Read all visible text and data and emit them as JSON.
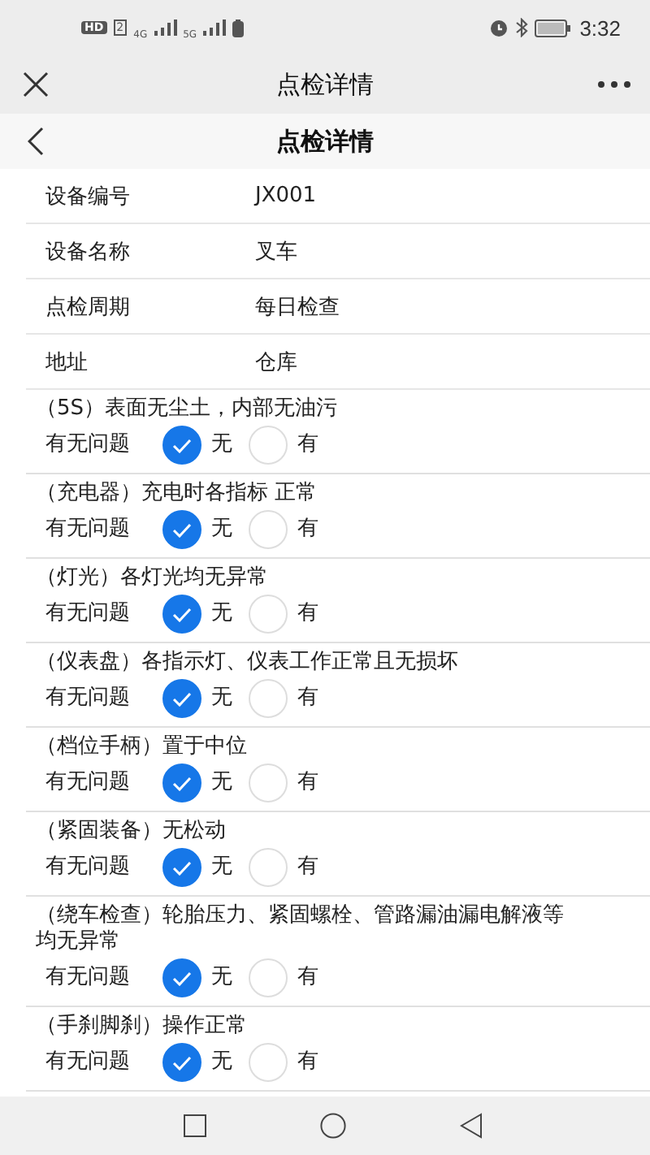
{
  "status_bar": {
    "time": "3:32",
    "hd": "HD",
    "sim": "2",
    "net_1": "4G",
    "net_2": "5G"
  },
  "header": {
    "title": "点检详情"
  },
  "subheader": {
    "title": "点检详情"
  },
  "info_rows": [
    {
      "label": "设备编号",
      "value": "JX001"
    },
    {
      "label": "设备名称",
      "value": "叉车"
    },
    {
      "label": "点检周期",
      "value": "每日检查"
    },
    {
      "label": "地址",
      "value": "仓库"
    }
  ],
  "check_items": [
    {
      "title": "（5S）表面无尘土，内部无油污",
      "question": "有无问题",
      "options": [
        {
          "label": "无",
          "selected": true
        },
        {
          "label": "有",
          "selected": false
        }
      ]
    },
    {
      "title": "（充电器）充电时各指标 正常",
      "question": "有无问题",
      "options": [
        {
          "label": "无",
          "selected": true
        },
        {
          "label": "有",
          "selected": false
        }
      ]
    },
    {
      "title": "（灯光）各灯光均无异常",
      "question": "有无问题",
      "options": [
        {
          "label": "无",
          "selected": true
        },
        {
          "label": "有",
          "selected": false
        }
      ]
    },
    {
      "title": "（仪表盘）各指示灯、仪表工作正常且无损坏",
      "question": "有无问题",
      "options": [
        {
          "label": "无",
          "selected": true
        },
        {
          "label": "有",
          "selected": false
        }
      ]
    },
    {
      "title": "（档位手柄）置于中位",
      "question": "有无问题",
      "options": [
        {
          "label": "无",
          "selected": true
        },
        {
          "label": "有",
          "selected": false
        }
      ]
    },
    {
      "title": "（紧固装备）无松动",
      "question": "有无问题",
      "options": [
        {
          "label": "无",
          "selected": true
        },
        {
          "label": "有",
          "selected": false
        }
      ]
    },
    {
      "title": "（绕车检查）轮胎压力、紧固螺栓、管路漏油漏电解液等均无异常",
      "question": "有无问题",
      "options": [
        {
          "label": "无",
          "selected": true
        },
        {
          "label": "有",
          "selected": false
        }
      ]
    },
    {
      "title": "（手刹脚刹）操作正常",
      "question": "有无问题",
      "options": [
        {
          "label": "无",
          "selected": true
        },
        {
          "label": "有",
          "selected": false
        }
      ]
    }
  ]
}
